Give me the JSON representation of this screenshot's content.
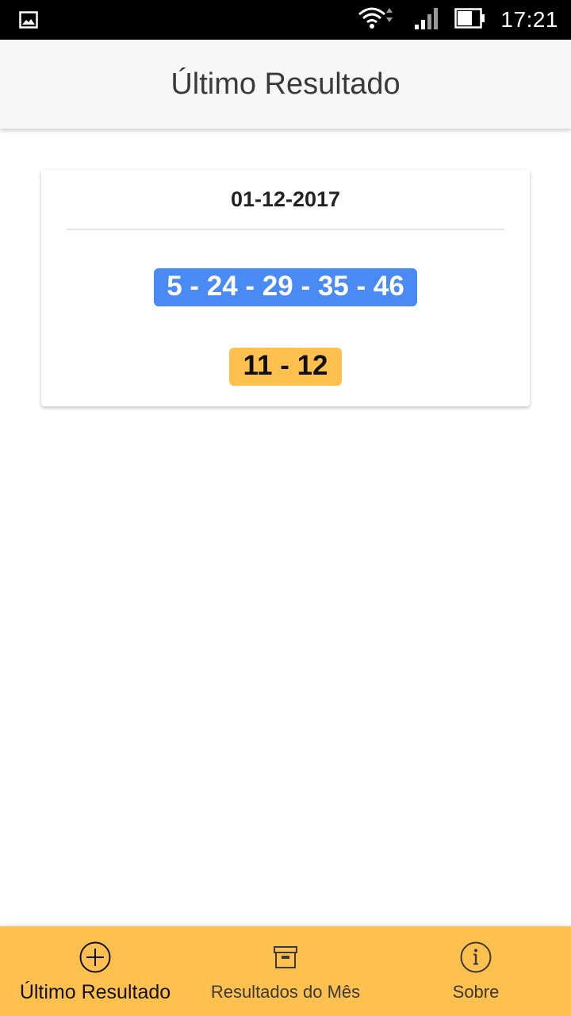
{
  "status_bar": {
    "time": "17:21",
    "icons": [
      "image-notification-icon",
      "wifi-icon",
      "signal-icon",
      "battery-icon"
    ]
  },
  "app_bar": {
    "title": "Último Resultado"
  },
  "result_card": {
    "date": "01-12-2017",
    "numbers": "5 - 24 - 29 - 35 - 46",
    "stars": "11 - 12"
  },
  "colors": {
    "numbers_badge": "#4a8af4",
    "stars_badge": "#ffc04d",
    "bottom_nav": "#ffc04d"
  },
  "bottom_nav": {
    "items": [
      {
        "label": "Último Resultado",
        "icon": "plus-circle-icon",
        "active": true
      },
      {
        "label": "Resultados do Mês",
        "icon": "archive-icon",
        "active": false
      },
      {
        "label": "Sobre",
        "icon": "info-icon",
        "active": false
      }
    ]
  }
}
